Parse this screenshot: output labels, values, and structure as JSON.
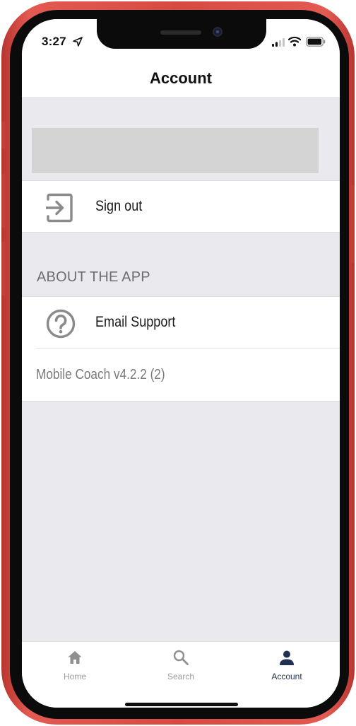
{
  "status_bar": {
    "time": "3:27",
    "location_icon": "location-arrow-icon",
    "signal_icon": "cellular-signal-icon",
    "wifi_icon": "wifi-icon",
    "battery_icon": "battery-icon"
  },
  "nav": {
    "title": "Account"
  },
  "account_rows": [
    {
      "label": "Sign out",
      "icon": "sign-out-icon"
    }
  ],
  "about_section": {
    "header": "ABOUT THE APP",
    "items": [
      {
        "label": "Email Support",
        "icon": "help-circle-icon"
      }
    ],
    "version": "Mobile Coach v4.2.2 (2)"
  },
  "tab_bar": {
    "tabs": [
      {
        "label": "Home",
        "icon": "home-icon",
        "active": false
      },
      {
        "label": "Search",
        "icon": "search-icon",
        "active": false
      },
      {
        "label": "Account",
        "icon": "person-icon",
        "active": true
      }
    ]
  },
  "colors": {
    "frame": "#d64a42",
    "background": "#e9e9ee",
    "placeholder": "#d4d4d4",
    "active_tab": "#1f3053",
    "inactive_tab": "#9a9a9a",
    "row_icon": "#8a8a8a"
  }
}
